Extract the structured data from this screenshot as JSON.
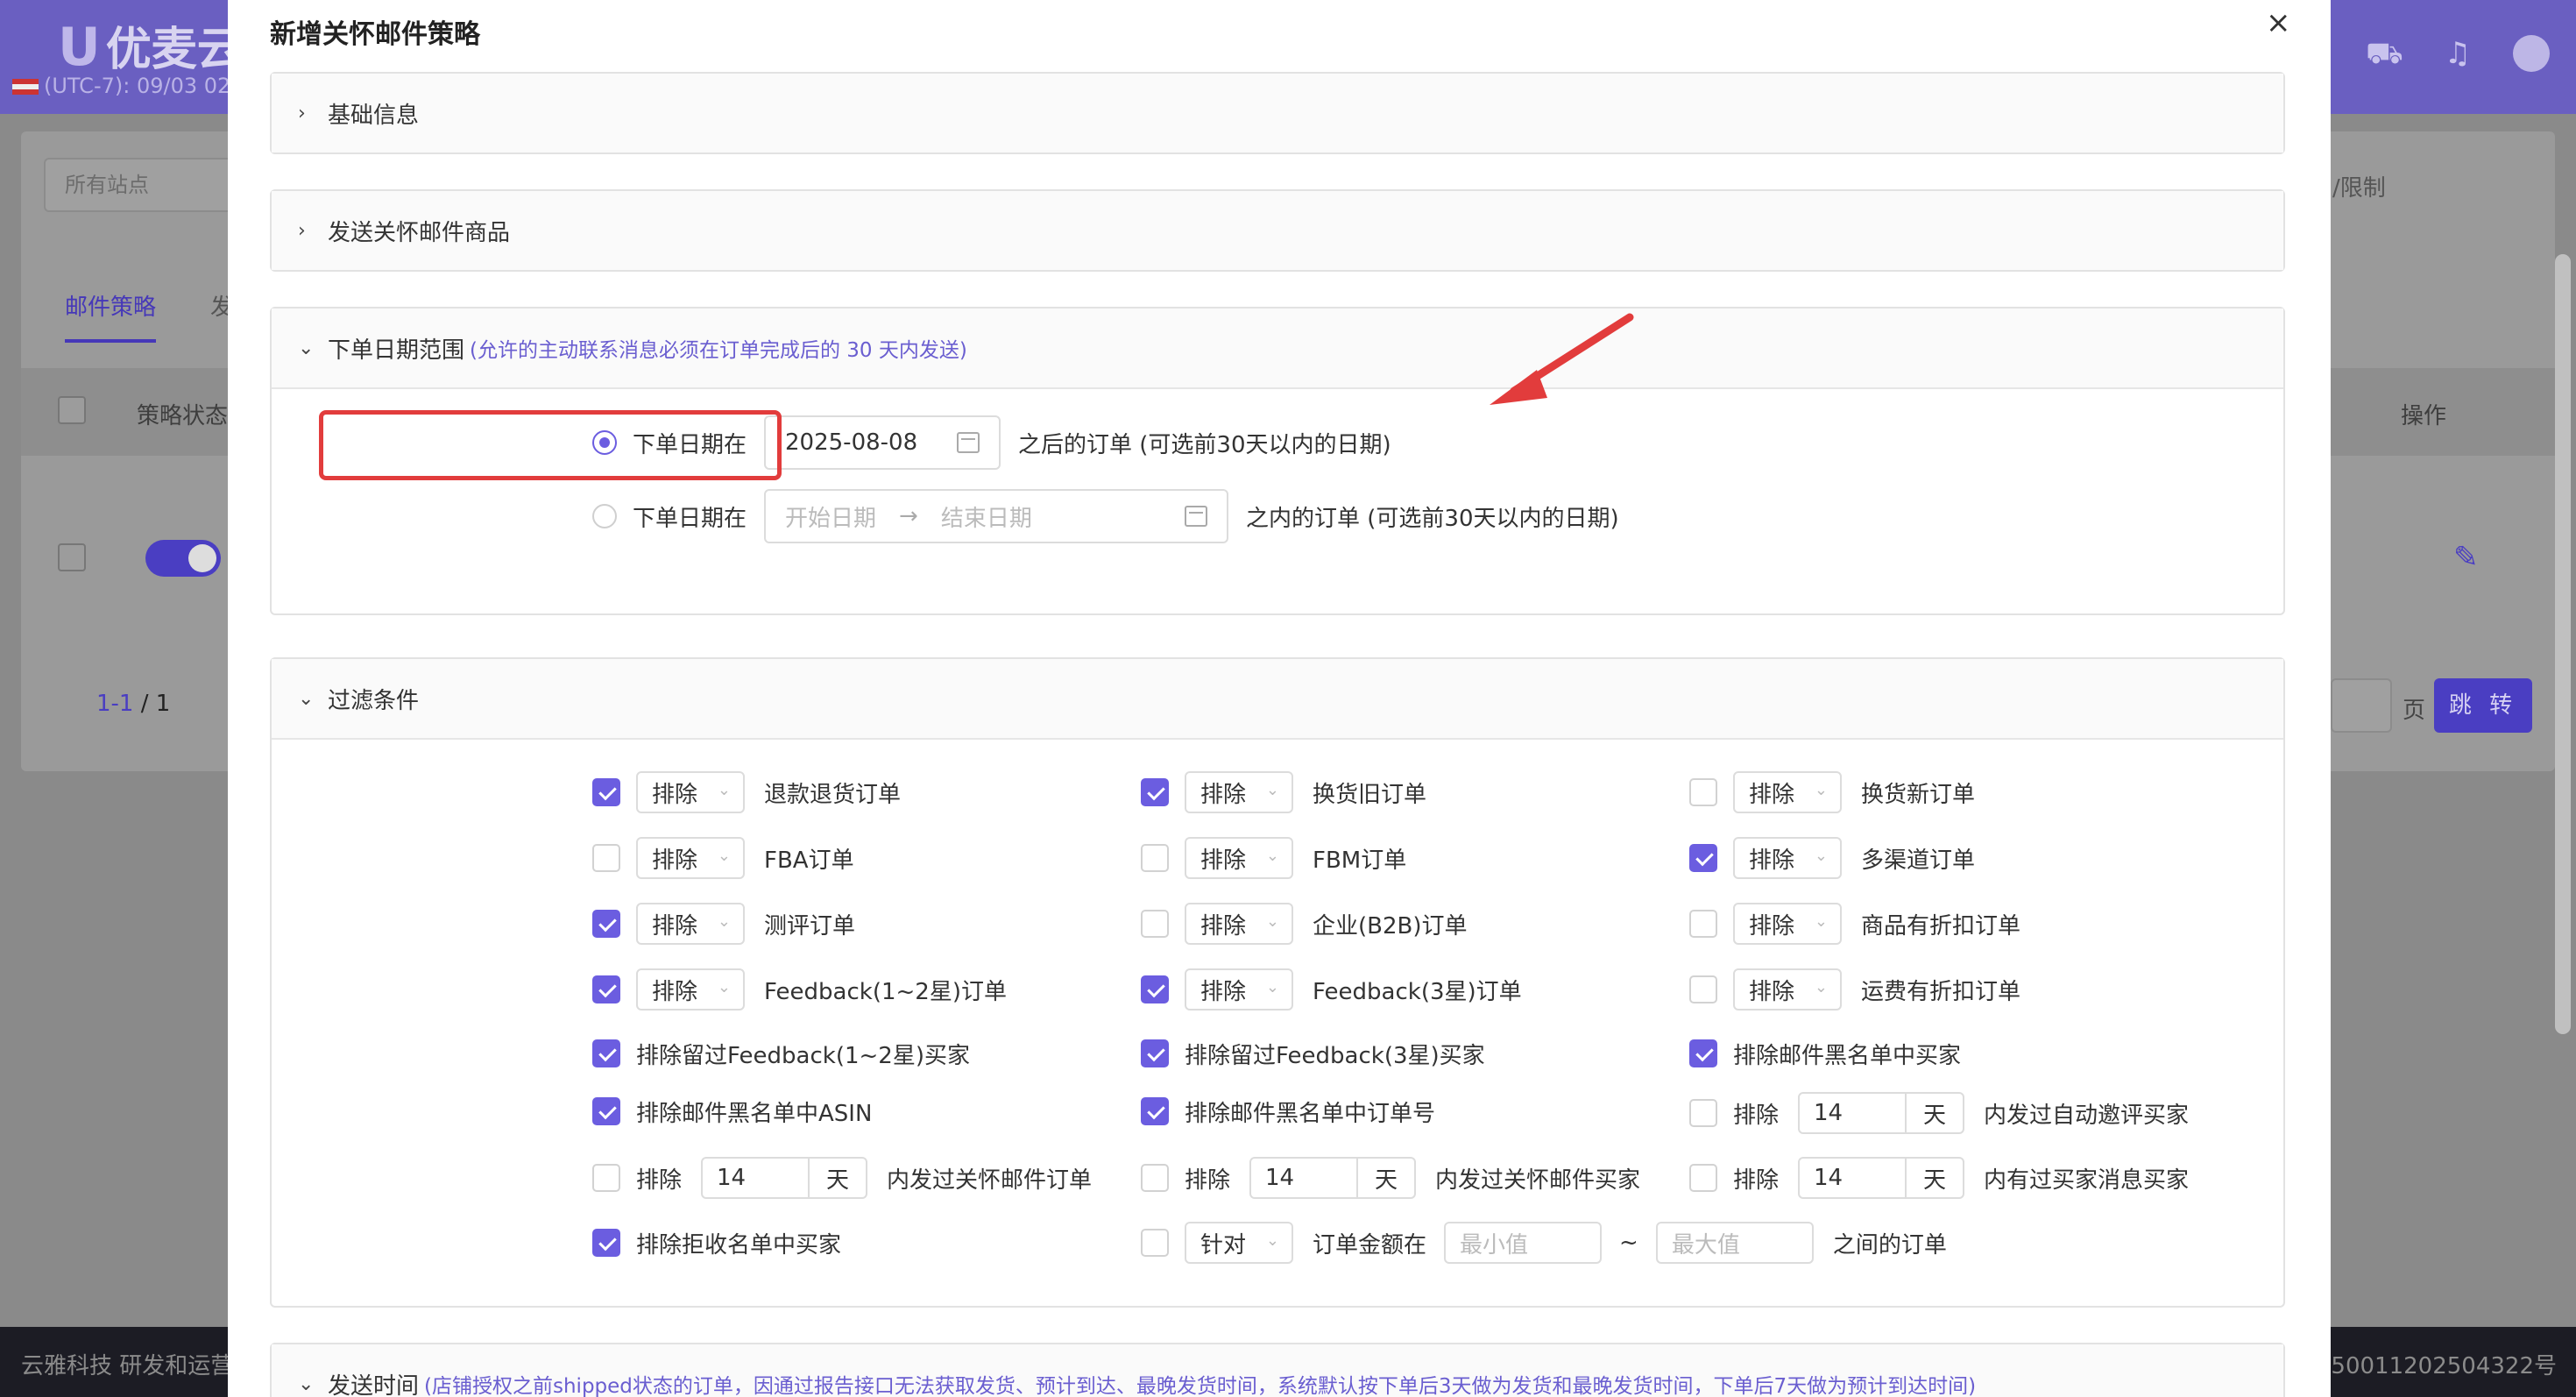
{
  "background": {
    "logo_text": "优麦云",
    "time_text": "(UTC-7): 09/03 02",
    "site_select_placeholder": "所有站点",
    "limit_link": "/限制",
    "tabs": [
      "邮件策略",
      "发"
    ],
    "columns": {
      "status": "策略状态",
      "ops": "操作"
    },
    "pagination": {
      "range": "1-1",
      "sep": "/",
      "total": "1",
      "page_word": "页",
      "jump": "跳 转"
    },
    "footer_left": "云雅科技 研发和运营",
    "footer_right": "50011202504322号"
  },
  "modal": {
    "title": "新增关怀邮件策略",
    "close": "×",
    "sections": {
      "basic": "基础信息",
      "products": "发送关怀邮件商品",
      "date_range": {
        "title": "下单日期范围",
        "note": "(允许的主动联系消息必须在订单完成后的 30 天内发送)",
        "option1_label": "下单日期在",
        "option1_value": "2025-08-08",
        "option1_suffix": "之后的订单 (可选前30天以内的日期)",
        "option2_label": "下单日期在",
        "option2_start_placeholder": "开始日期",
        "option2_end_placeholder": "结束日期",
        "option2_suffix": "之内的订单 (可选前30天以内的日期)",
        "selected_option": 1
      },
      "filters": {
        "title": "过滤条件",
        "exclude": "排除",
        "target": "针对",
        "day": "天",
        "grid": [
          {
            "checked": true,
            "label": "退款退货订单"
          },
          {
            "checked": true,
            "label": "换货旧订单"
          },
          {
            "checked": false,
            "label": "换货新订单"
          },
          {
            "checked": false,
            "label": "FBA订单"
          },
          {
            "checked": false,
            "label": "FBM订单"
          },
          {
            "checked": true,
            "label": "多渠道订单"
          },
          {
            "checked": true,
            "label": "测评订单"
          },
          {
            "checked": false,
            "label": "企业(B2B)订单"
          },
          {
            "checked": false,
            "label": "商品有折扣订单"
          },
          {
            "checked": true,
            "label": "Feedback(1~2星)订单"
          },
          {
            "checked": true,
            "label": "Feedback(3星)订单"
          },
          {
            "checked": false,
            "label": "运费有折扣订单"
          }
        ],
        "simple": [
          {
            "checked": true,
            "label": "排除留过Feedback(1~2星)买家"
          },
          {
            "checked": true,
            "label": "排除留过Feedback(3星)买家"
          },
          {
            "checked": true,
            "label": "排除邮件黑名单中买家"
          },
          {
            "checked": true,
            "label": "排除邮件黑名单中ASIN"
          },
          {
            "checked": true,
            "label": "排除邮件黑名单中订单号"
          }
        ],
        "days_rows": [
          {
            "checked": false,
            "value": "14",
            "label": "内发过自动邀评买家"
          },
          {
            "checked": false,
            "value": "14",
            "label": "内发过关怀邮件订单"
          },
          {
            "checked": false,
            "value": "14",
            "label": "内发过关怀邮件买家"
          },
          {
            "checked": false,
            "value": "14",
            "label": "内有过买家消息买家"
          }
        ],
        "reject": {
          "checked": true,
          "label": "排除拒收名单中买家"
        },
        "amount": {
          "checked": false,
          "prefix": "订单金额在",
          "min_placeholder": "最小值",
          "tilde": "~",
          "max_placeholder": "最大值",
          "suffix": "之间的订单"
        }
      },
      "send_time": {
        "title": "发送时间",
        "note": "(店铺授权之前shipped状态的订单，因通过报告接口无法获取发货、预计到达、最晚发货时间，系统默认按下单后3天做为发货和最晚发货时间，下单后7天做为预计到达时间)"
      }
    }
  },
  "colors": {
    "accent": "#6b5de0",
    "highlight": "#e23c3c",
    "header": "#6a5fc1"
  }
}
